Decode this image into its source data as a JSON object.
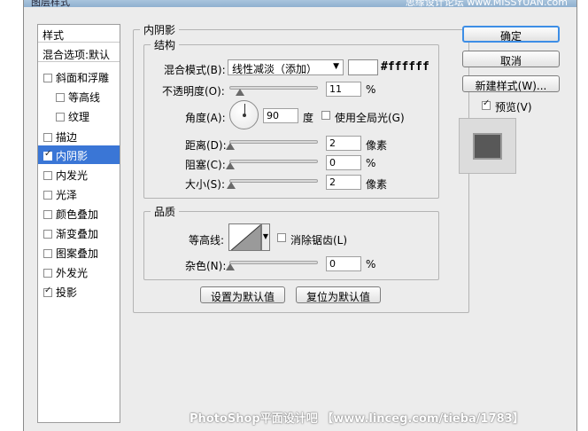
{
  "window": {
    "title": "图层样式",
    "title_right": "思缘设计论坛 www.MISSYUAN.com"
  },
  "left_panel": {
    "header": "样式",
    "blend_options": "混合选项:默认",
    "items": [
      {
        "label": "斜面和浮雕",
        "checked": false
      },
      {
        "label": "等高线",
        "checked": false
      },
      {
        "label": "纹理",
        "checked": false
      },
      {
        "label": "描边",
        "checked": false
      },
      {
        "label": "内阴影",
        "checked": true,
        "selected": true
      },
      {
        "label": "内发光",
        "checked": false
      },
      {
        "label": "光泽",
        "checked": false
      },
      {
        "label": "颜色叠加",
        "checked": false
      },
      {
        "label": "渐变叠加",
        "checked": false
      },
      {
        "label": "图案叠加",
        "checked": false
      },
      {
        "label": "外发光",
        "checked": false
      },
      {
        "label": "投影",
        "checked": true
      }
    ]
  },
  "inner_shadow": {
    "title": "内阴影",
    "structure": {
      "title": "结构",
      "blend_mode_label": "混合模式(B):",
      "blend_mode_value": "线性减淡（添加）",
      "color_hex": "#ffffff",
      "opacity_label": "不透明度(O):",
      "opacity_value": "11",
      "opacity_unit": "%",
      "opacity_fraction": 0.11,
      "angle_label": "角度(A):",
      "angle_value": "90",
      "angle_unit": "度",
      "global_light_label": "使用全局光(G)",
      "global_light_checked": false,
      "distance_label": "距离(D):",
      "distance_value": "2",
      "distance_unit": "像素",
      "choke_label": "阻塞(C):",
      "choke_value": "0",
      "choke_unit": "%",
      "size_label": "大小(S):",
      "size_value": "2",
      "size_unit": "像素"
    },
    "quality": {
      "title": "品质",
      "contour_label": "等高线:",
      "anti_alias_label": "消除锯齿(L)",
      "anti_alias_checked": false,
      "noise_label": "杂色(N):",
      "noise_value": "0",
      "noise_unit": "%"
    },
    "make_default": "设置为默认值",
    "reset_default": "复位为默认值"
  },
  "buttons": {
    "ok": "确定",
    "cancel": "取消",
    "new_style": "新建样式(W)...",
    "preview_label": "预览(V)",
    "preview_checked": true
  },
  "watermark": "PhotoShop平面设计吧 【www.linceg.com/tieba/1783】"
}
